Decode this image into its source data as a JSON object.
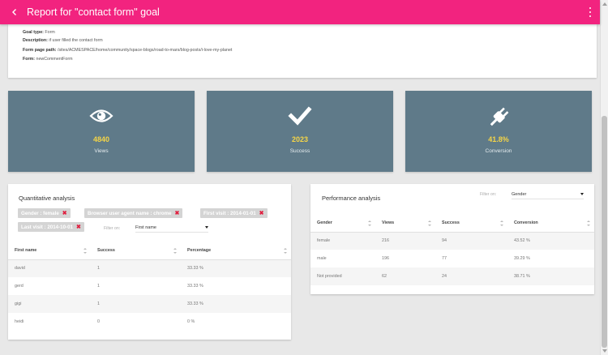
{
  "header": {
    "title": "Report for \"contact form\" goal",
    "accent": "#f2237f"
  },
  "goal": {
    "type_label": "Goal type:",
    "type_value": "Form",
    "description_label": "Description:",
    "description_value": "if user filled the contact form",
    "path_label": "Form page path:",
    "path_value": "/sites/ACMESPACE/home/community/space-blogs/road-to-mars/blog-posts/i-love-my-planet",
    "form_label": "Form:",
    "form_value": "newCommentForm"
  },
  "stats": [
    {
      "icon": "eye-icon",
      "value": "4840",
      "label": "Views"
    },
    {
      "icon": "checkmark-icon",
      "value": "2023",
      "label": "Success"
    },
    {
      "icon": "plug-icon",
      "value": "41.8%",
      "label": "Conversion"
    }
  ],
  "quantitative": {
    "title": "Quantitative analysis",
    "chips": [
      {
        "label": "Gender : female"
      },
      {
        "label": "Browser user agent name : chrome"
      },
      {
        "label": "First visit : 2014-01-01"
      },
      {
        "label": "Last visit : 2014-10-01"
      }
    ],
    "filter_label": "Filter on:",
    "filter_value": "First name",
    "columns": [
      "First name",
      "Success",
      "Percentage"
    ],
    "rows": [
      [
        "david",
        "1",
        "33.33 %"
      ],
      [
        "gerd",
        "1",
        "33.33 %"
      ],
      [
        "gigi",
        "1",
        "33.33 %"
      ],
      [
        "heidi",
        "0",
        "0 %"
      ]
    ]
  },
  "performance": {
    "title": "Performance analysis",
    "filter_label": "Filter on:",
    "filter_value": "Gender",
    "columns": [
      "Gender",
      "Views",
      "Success",
      "Conversion"
    ],
    "rows": [
      [
        "female",
        "216",
        "94",
        "43.52 %"
      ],
      [
        "male",
        "196",
        "77",
        "39.29 %"
      ],
      [
        "Not provided",
        "62",
        "24",
        "38.71 %"
      ]
    ]
  },
  "colors": {
    "stat_background": "#5f7a89",
    "stat_value": "#f5d547",
    "chip_remove": "#e02040"
  }
}
